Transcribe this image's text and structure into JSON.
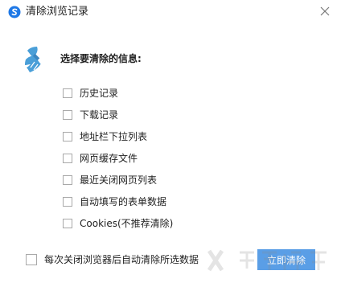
{
  "window": {
    "title": "清除浏览记录",
    "app_icon": "sogou-browser-icon",
    "close_icon": "close-icon"
  },
  "dialog": {
    "heading": "选择要清除的信息:",
    "heading_icon": "broom-icon",
    "options": [
      {
        "label": "历史记录",
        "checked": false
      },
      {
        "label": "下载记录",
        "checked": false
      },
      {
        "label": "地址栏下拉列表",
        "checked": false
      },
      {
        "label": "网页缓存文件",
        "checked": false
      },
      {
        "label": "最近关闭网页列表",
        "checked": false
      },
      {
        "label": "自动填写的表单数据",
        "checked": false
      },
      {
        "label": "Cookies(不推荐清除)",
        "checked": false
      }
    ]
  },
  "footer": {
    "auto_clear_label": "每次关闭浏览器后自动清除所选数据",
    "auto_clear_checked": false,
    "action_label": "立即清除"
  },
  "colors": {
    "accent": "#5a9ee6",
    "checkbox_border": "#a9a9a9",
    "broom": "#4a9fd8"
  }
}
